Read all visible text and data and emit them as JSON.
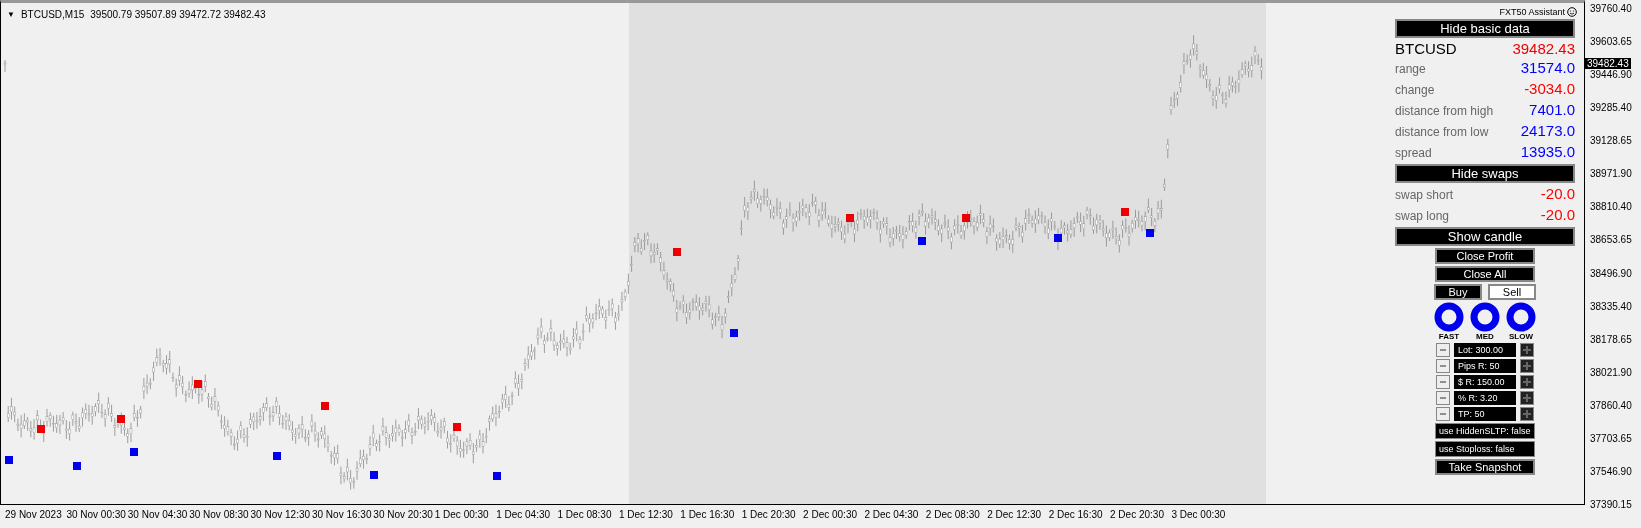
{
  "chart": {
    "menu_glyph": "▼",
    "symbol": "BTCUSD,M15",
    "ohlc": "39500.79 39507.89 39472.72 39482.43",
    "current_price": "39482.43",
    "price_axis": [
      "39760.40",
      "39603.65",
      "39446.90",
      "39285.40",
      "39128.65",
      "38971.90",
      "38810.40",
      "38653.65",
      "38496.90",
      "38335.40",
      "38178.65",
      "38021.90",
      "37860.40",
      "37703.65",
      "37546.90",
      "37390.15"
    ],
    "time_axis": [
      "29 Nov 2023",
      "30 Nov 00:30",
      "30 Nov 04:30",
      "30 Nov 08:30",
      "30 Nov 12:30",
      "30 Nov 16:30",
      "30 Nov 20:30",
      "1 Dec 00:30",
      "1 Dec 04:30",
      "1 Dec 08:30",
      "1 Dec 12:30",
      "1 Dec 16:30",
      "1 Dec 20:30",
      "2 Dec 00:30",
      "2 Dec 04:30",
      "2 Dec 08:30",
      "2 Dec 12:30",
      "2 Dec 16:30",
      "2 Dec 20:30",
      "3 Dec 00:30"
    ]
  },
  "assistant": {
    "title": "FXT50 Assistant",
    "basic_toggle": "Hide basic data",
    "symbol": "BTCUSD",
    "price": "39482.43",
    "stats": [
      {
        "label": "range",
        "value": "31574.0",
        "color": "#0000ff"
      },
      {
        "label": "change",
        "value": "-3034.0",
        "color": "#ff0000"
      },
      {
        "label": "distance from high",
        "value": "7401.0",
        "color": "#0000ff"
      },
      {
        "label": "distance from low",
        "value": "24173.0",
        "color": "#0000ff"
      },
      {
        "label": "spread",
        "value": "13935.0",
        "color": "#0000ff"
      }
    ],
    "swaps_toggle": "Hide swaps",
    "swaps": [
      {
        "label": "swap short",
        "value": "-20.0",
        "color": "#ff0000"
      },
      {
        "label": "swap long",
        "value": "-20.0",
        "color": "#ff0000"
      }
    ],
    "candle_toggle": "Show candle",
    "close_buttons": [
      "Close Profit",
      "Close All"
    ],
    "trade_buttons": [
      {
        "label": "Buy",
        "kind": "filled"
      },
      {
        "label": "Sell",
        "kind": "outline"
      }
    ],
    "speeds": [
      "FAST",
      "MED",
      "SLOW"
    ],
    "steppers": [
      "Lot: 300.00",
      "Pips R: 50",
      "$ R: 150.00",
      "% R: 3.20",
      "TP: 50"
    ],
    "toggles": [
      "use HiddenSLTP: false",
      "use Stoploss: false"
    ],
    "snapshot": "Take Snapshot"
  }
}
